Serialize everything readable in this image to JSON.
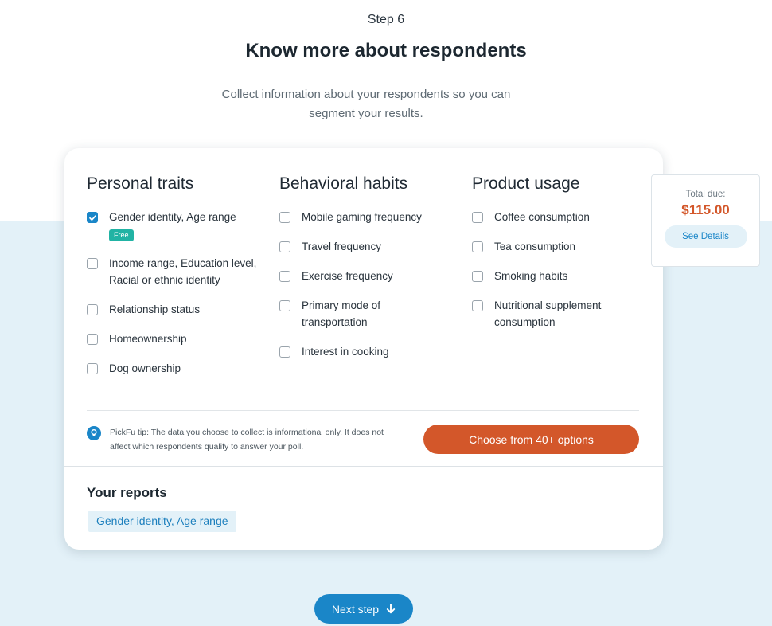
{
  "header": {
    "step": "Step 6",
    "title": "Know more about respondents",
    "subtitle": "Collect information about your respondents so you can segment your results."
  },
  "columns": [
    {
      "heading": "Personal traits",
      "options": [
        {
          "label": "Gender identity, Age range",
          "checked": true,
          "badge": "Free"
        },
        {
          "label": "Income range, Education level, Racial or ethnic identity",
          "checked": false
        },
        {
          "label": "Relationship status",
          "checked": false
        },
        {
          "label": "Homeownership",
          "checked": false
        },
        {
          "label": "Dog ownership",
          "checked": false
        }
      ]
    },
    {
      "heading": "Behavioral habits",
      "options": [
        {
          "label": "Mobile gaming frequency",
          "checked": false
        },
        {
          "label": "Travel frequency",
          "checked": false
        },
        {
          "label": "Exercise frequency",
          "checked": false
        },
        {
          "label": "Primary mode of transportation",
          "checked": false
        },
        {
          "label": "Interest in cooking",
          "checked": false
        }
      ]
    },
    {
      "heading": "Product usage",
      "options": [
        {
          "label": "Coffee consumption",
          "checked": false
        },
        {
          "label": "Tea consumption",
          "checked": false
        },
        {
          "label": "Smoking habits",
          "checked": false
        },
        {
          "label": "Nutritional supplement consumption",
          "checked": false
        }
      ]
    }
  ],
  "tip": {
    "icon": "lightbulb-icon",
    "text": "PickFu tip: The data you choose to collect is informational only. It does not affect which respondents qualify to answer your poll."
  },
  "choose_button": "Choose from 40+ options",
  "reports": {
    "title": "Your reports",
    "tags": [
      "Gender identity, Age range"
    ]
  },
  "total": {
    "label": "Total due:",
    "amount": "$115.00",
    "details_button": "See Details"
  },
  "next_button": {
    "label": "Next step",
    "icon": "arrow-down-icon"
  },
  "colors": {
    "accent_blue": "#1a86c8",
    "accent_orange": "#d3572a",
    "badge_teal": "#21b3a4",
    "band_bg": "#e3f1f8"
  }
}
